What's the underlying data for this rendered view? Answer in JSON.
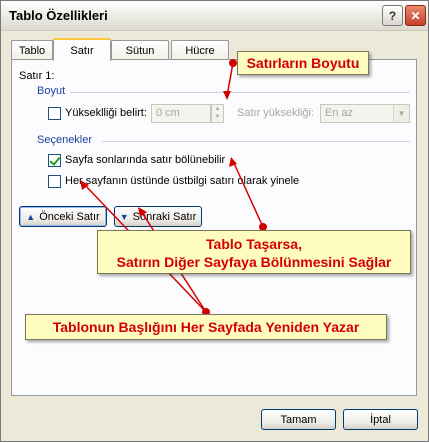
{
  "window": {
    "title": "Tablo Özellikleri",
    "help_glyph": "?",
    "close_glyph": "✕"
  },
  "tabs": [
    {
      "label": "Tablo",
      "active": false
    },
    {
      "label": "Satır",
      "active": true
    },
    {
      "label": "Sütun",
      "active": false
    },
    {
      "label": "Hücre",
      "active": false
    }
  ],
  "row_header": "Satır 1:",
  "size_group": {
    "title": "Boyut",
    "height_checkbox_label": "Yükseklliği belirt:",
    "height_checked": false,
    "height_value": "0 cm",
    "row_height_label": "Satır yüksekliği:",
    "row_height_value": "En az"
  },
  "options_group": {
    "title": "Seçenekler",
    "allow_break_label": "Sayfa sonlarında satır bölünebilir",
    "allow_break_checked": true,
    "repeat_header_label": "Her sayfanın üstünde üstbilgi satırı olarak yinele",
    "repeat_header_checked": false
  },
  "nav_buttons": {
    "previous": "Önceki Satır",
    "next": "Sonraki Satır"
  },
  "footer": {
    "ok": "Tamam",
    "cancel": "İptal"
  },
  "annotations": {
    "size_callout": "Satırların Boyutu",
    "break_callout_line1": "Tablo Taşarsa,",
    "break_callout_line2": "Satırın Diğer Sayfaya Bölünmesini Sağlar",
    "header_callout": "Tablonun Başlığını Her Sayfada Yeniden Yazar"
  },
  "colors": {
    "callout_text": "#d40000",
    "callout_bg": "#fffcbf",
    "group_title": "#1c3fa0",
    "active_tab_accent": "#ffc83c"
  }
}
